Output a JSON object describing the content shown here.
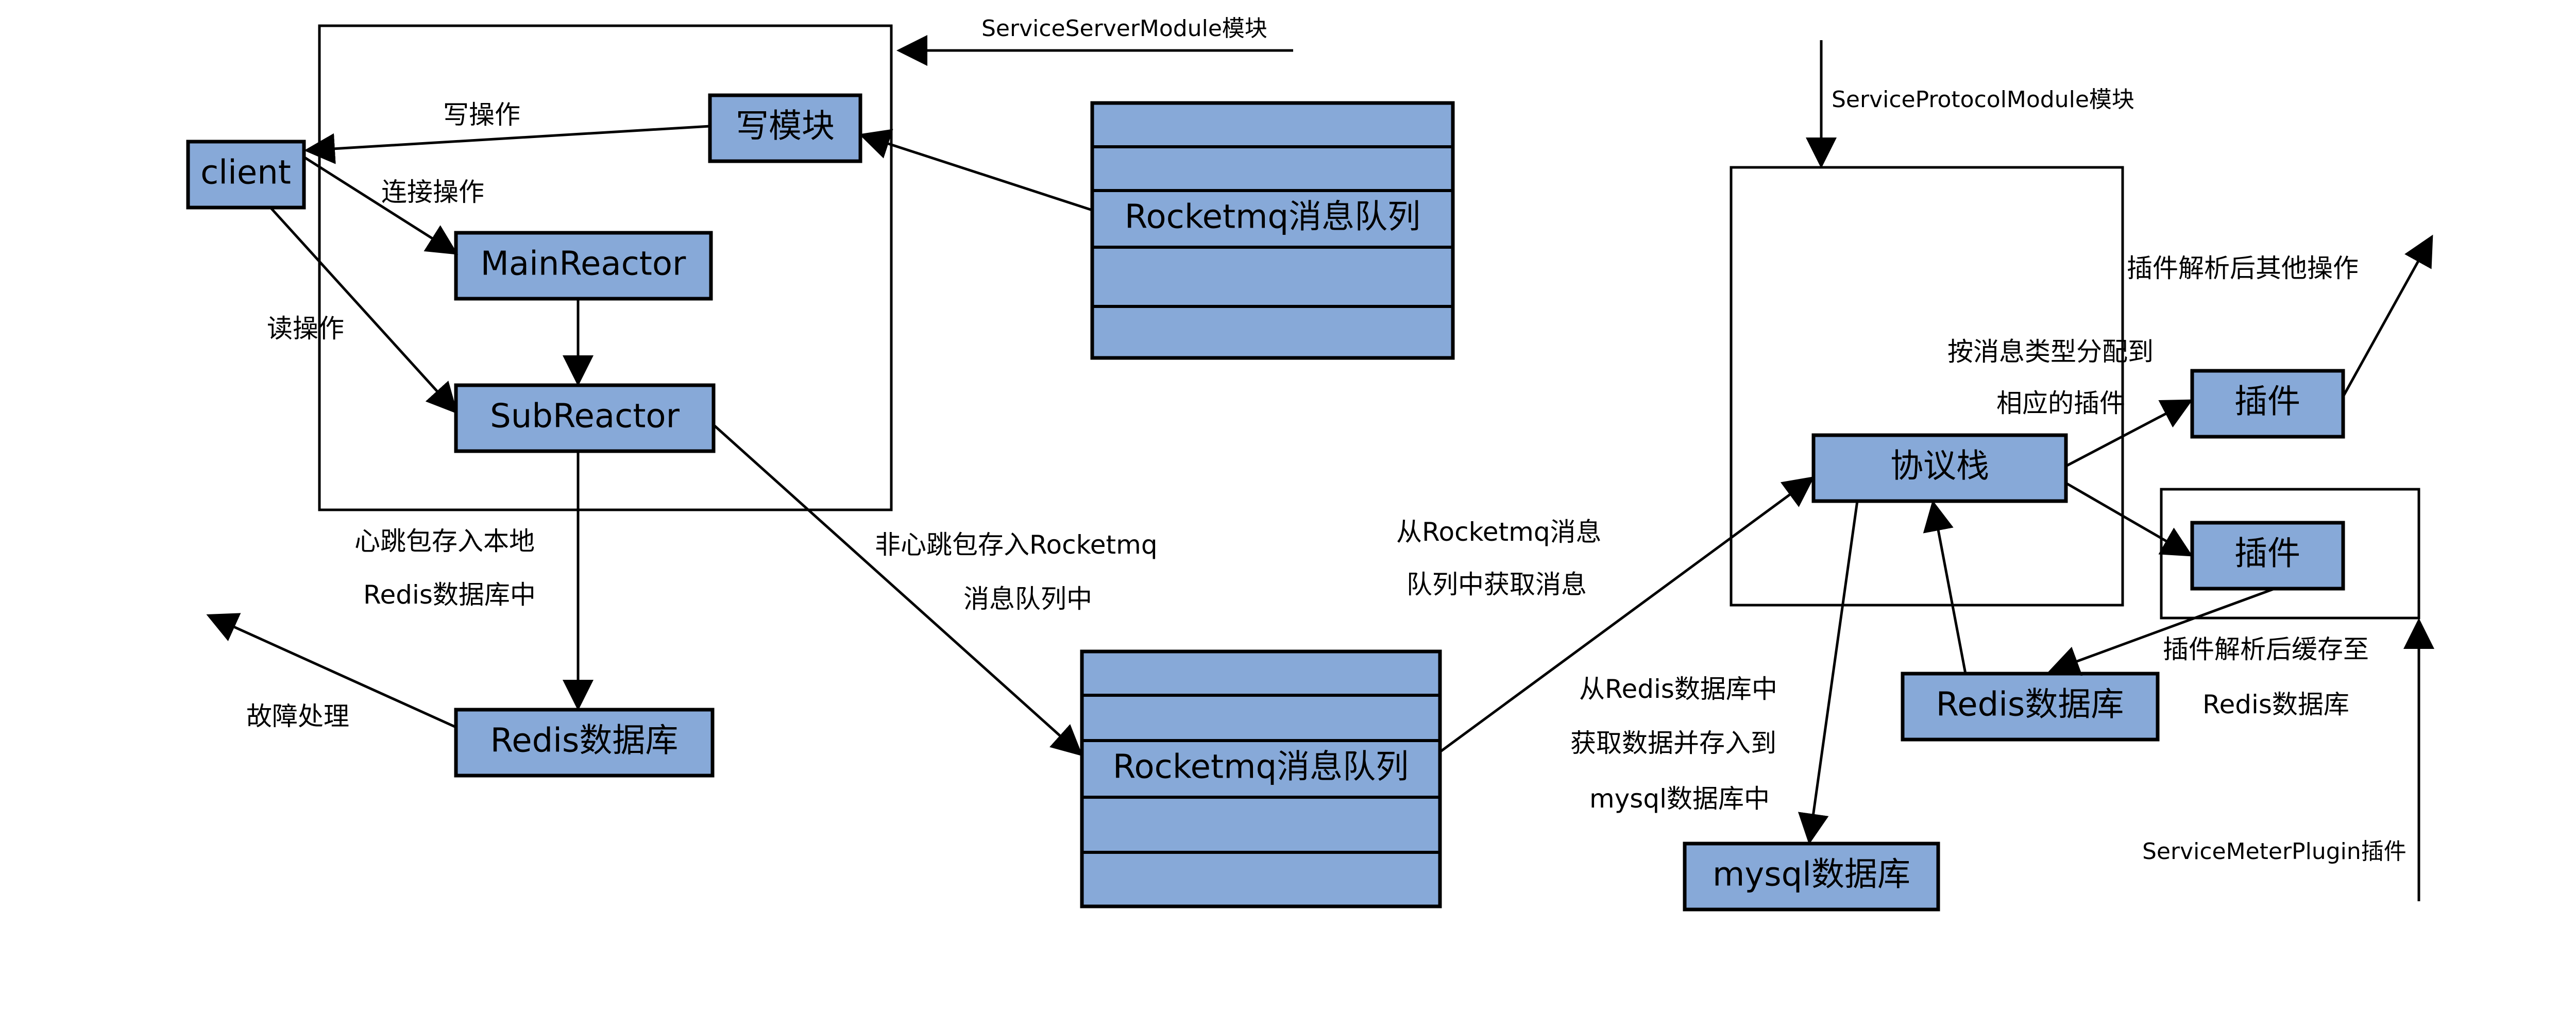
{
  "colors": {
    "box_fill": "#87A9D8",
    "stroke": "#000000",
    "background": "#FFFFFF"
  },
  "labels": {
    "service_server_module": "ServiceServerModule模块",
    "service_protocol_module": "ServiceProtocolModule模块",
    "service_meter_plugin": "ServiceMeterPlugin插件",
    "write_op": "写操作",
    "connect_op": "连接操作",
    "read_op": "读操作",
    "heartbeat_line1": "心跳包存入本地",
    "heartbeat_line2": "Redis数据库中",
    "fault_handling": "故障处理",
    "non_heartbeat_line1": "非心跳包存入Rocketmq",
    "non_heartbeat_line2": "消息队列中",
    "fetch_line1": "从Rocketmq消息",
    "fetch_line2": "队列中获取消息",
    "dispatch_line1": "按消息类型分配到",
    "dispatch_line2": "相应的插件",
    "plugin_other_ops": "插件解析后其他操作",
    "redis_fetch_line1": "从Redis数据库中",
    "redis_fetch_line2": "获取数据并存入到",
    "redis_fetch_line3": "mysql数据库中",
    "plugin_cache_line1": "插件解析后缓存至",
    "plugin_cache_line2": "Redis数据库"
  },
  "nodes": {
    "client": "client",
    "write_module": "写模块",
    "main_reactor": "MainReactor",
    "sub_reactor": "SubReactor",
    "redis_db_left": "Redis数据库",
    "rocketmq_top": "Rocketmq消息队列",
    "rocketmq_center": "Rocketmq消息队列",
    "protocol_stack": "协议栈",
    "plugin_1": "插件",
    "plugin_2": "插件",
    "redis_db_right": "Redis数据库",
    "mysql_db": "mysql数据库"
  }
}
